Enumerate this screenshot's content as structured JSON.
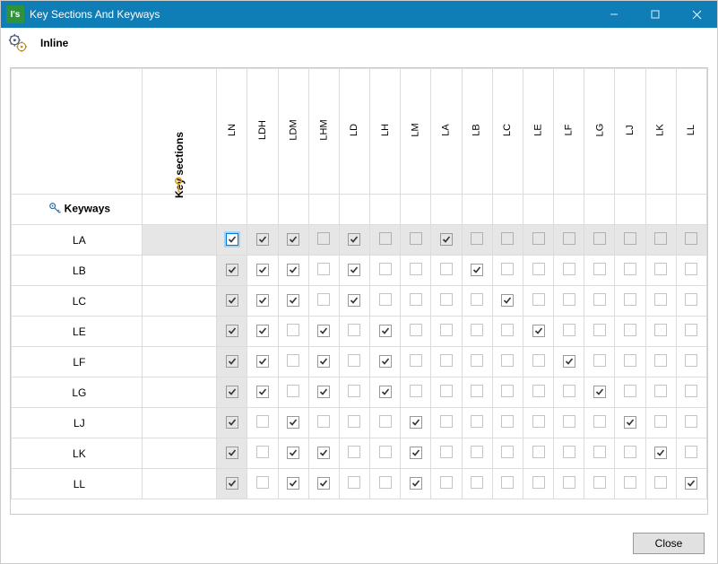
{
  "titlebar": {
    "app_badge": "I's",
    "title": "Key Sections And Keyways"
  },
  "toolbar": {
    "mode_label": "Inline"
  },
  "table": {
    "keysections_label": "Key sections",
    "keyways_label": "Keyways",
    "columns": [
      "LN",
      "LDH",
      "LDM",
      "LHM",
      "LD",
      "LH",
      "LM",
      "LA",
      "LB",
      "LC",
      "LE",
      "LF",
      "LG",
      "LJ",
      "LK",
      "LL"
    ],
    "la_row_index": 0,
    "selected_cell": {
      "row": 0,
      "col": 0
    },
    "rows": [
      {
        "label": "LA",
        "checks": [
          true,
          true,
          true,
          false,
          true,
          false,
          false,
          true,
          false,
          false,
          false,
          false,
          false,
          false,
          false,
          false
        ]
      },
      {
        "label": "LB",
        "checks": [
          true,
          true,
          true,
          false,
          true,
          false,
          false,
          false,
          true,
          false,
          false,
          false,
          false,
          false,
          false,
          false
        ]
      },
      {
        "label": "LC",
        "checks": [
          true,
          true,
          true,
          false,
          true,
          false,
          false,
          false,
          false,
          true,
          false,
          false,
          false,
          false,
          false,
          false
        ]
      },
      {
        "label": "LE",
        "checks": [
          true,
          true,
          false,
          true,
          false,
          true,
          false,
          false,
          false,
          false,
          true,
          false,
          false,
          false,
          false,
          false
        ]
      },
      {
        "label": "LF",
        "checks": [
          true,
          true,
          false,
          true,
          false,
          true,
          false,
          false,
          false,
          false,
          false,
          true,
          false,
          false,
          false,
          false
        ]
      },
      {
        "label": "LG",
        "checks": [
          true,
          true,
          false,
          true,
          false,
          true,
          false,
          false,
          false,
          false,
          false,
          false,
          true,
          false,
          false,
          false
        ]
      },
      {
        "label": "LJ",
        "checks": [
          true,
          false,
          true,
          false,
          false,
          false,
          true,
          false,
          false,
          false,
          false,
          false,
          false,
          true,
          false,
          false
        ]
      },
      {
        "label": "LK",
        "checks": [
          true,
          false,
          true,
          true,
          false,
          false,
          true,
          false,
          false,
          false,
          false,
          false,
          false,
          false,
          true,
          false
        ]
      },
      {
        "label": "LL",
        "checks": [
          true,
          false,
          true,
          true,
          false,
          false,
          true,
          false,
          false,
          false,
          false,
          false,
          false,
          false,
          false,
          true
        ]
      }
    ]
  },
  "footer": {
    "close_label": "Close"
  }
}
